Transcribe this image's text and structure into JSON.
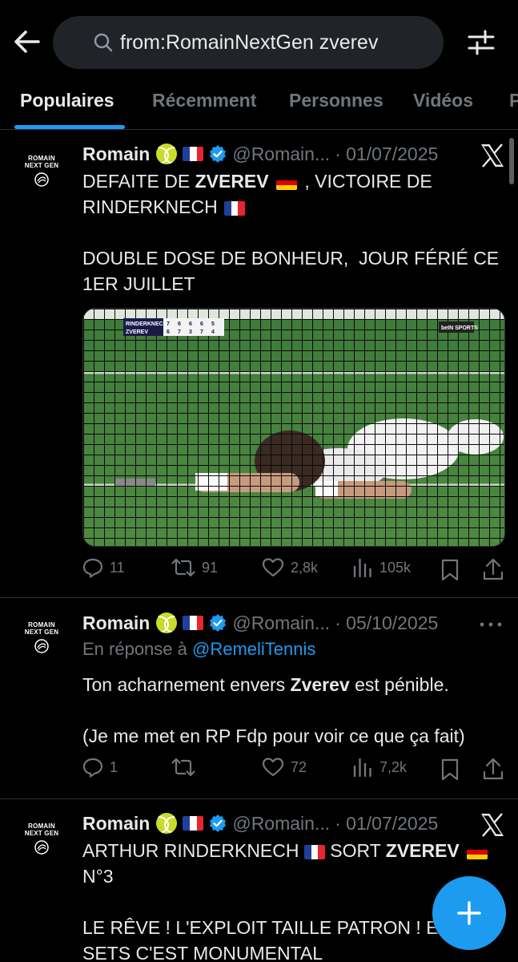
{
  "search": {
    "query": "from:RomainNextGen zverev"
  },
  "tabs": [
    {
      "label": "Populaires",
      "active": true
    },
    {
      "label": "Récemment"
    },
    {
      "label": "Personnes"
    },
    {
      "label": "Vidéos"
    },
    {
      "label": "P"
    }
  ],
  "colors": {
    "accent": "#1d9bf0",
    "background": "#000000",
    "muted": "#71767b"
  },
  "avatar": {
    "line1": "ROMAIN",
    "line2": "NEXT GEN"
  },
  "tweets": [
    {
      "author": "Romain",
      "handle": "@Romain...",
      "date": "· 01/07/2025",
      "corner_icon": "x-logo-icon",
      "text_line1_pre": "DEFAITE DE ",
      "text_line1_bold": "ZVEREV",
      "text_line1_post": " , VICTOIRE DE",
      "text_line2": "RINDERKNECH",
      "text_para2": "DOUBLE DOSE DE BONHEUR,  JOUR FÉRIÉ CE 1ER JUILLET",
      "media": {
        "score_names": [
          "RINDERKNECH",
          "ZVEREV"
        ],
        "score_sets_p1": [
          "7",
          "6",
          "6",
          "6",
          "5"
        ],
        "score_sets_p2": [
          "6",
          "7",
          "3",
          "7",
          "4"
        ],
        "tv_label": "beIN SPORTS"
      },
      "stats": {
        "replies": "11",
        "reposts": "91",
        "likes": "2,8k",
        "views": "105k"
      }
    },
    {
      "author": "Romain",
      "handle": "@Romain...",
      "date": "· 05/10/2025",
      "corner_icon": "more-dots-icon",
      "reply_prefix": "En réponse à ",
      "reply_mention": "@RemeliTennis",
      "text_pre": "Ton acharnement envers ",
      "text_bold": "Zverev",
      "text_post": " est pénible.",
      "text_para2": "(Je me met en RP Fdp pour voir ce que ça fait)",
      "stats": {
        "replies": "1",
        "reposts": "",
        "likes": "72",
        "views": "7,2k"
      }
    },
    {
      "author": "Romain",
      "handle": "@Romain...",
      "date": "· 01/07/2025",
      "corner_icon": "x-logo-icon",
      "text_line1_pre": "ARTHUR RINDERKNECH ",
      "text_line1_mid": " SORT ",
      "text_line1_bold": "ZVEREV",
      "text_line2": "N°3",
      "text_para2_line1": "LE RÊVE ! L'EXPLOIT TAILLE PATRON ! E",
      "text_para2_line2": "SETS C'EST MONUMENTAL"
    }
  ]
}
